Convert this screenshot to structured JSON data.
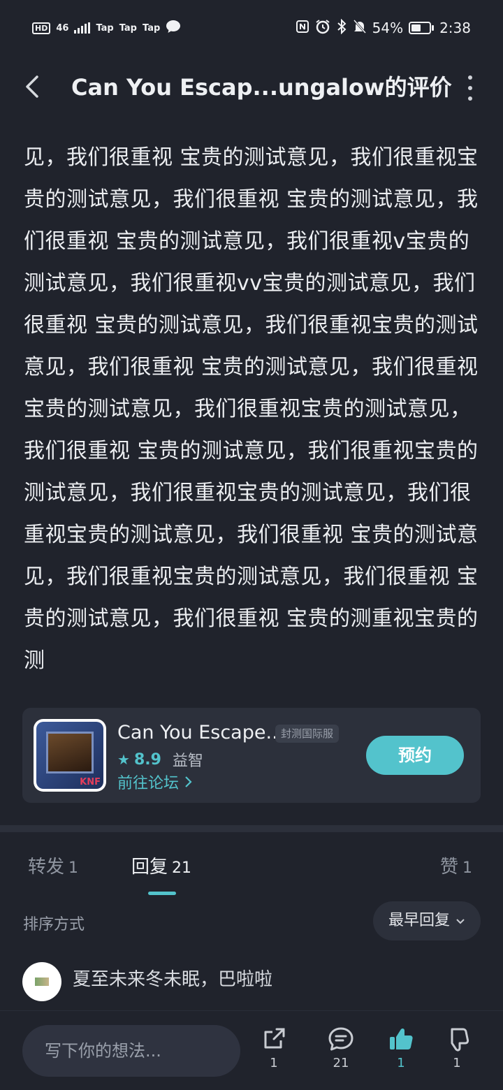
{
  "status_bar": {
    "left_items": [
      "HD",
      "46",
      "Tap",
      "Tap",
      "Tap"
    ],
    "battery_percent": "54%",
    "battery_level": 0.54,
    "time": "2:38"
  },
  "header": {
    "title": "Can You Escap...ungalow的评价"
  },
  "review": {
    "text": "见，我们很重视 宝贵的测试意见，我们很重视宝贵的测试意见，我们很重视 宝贵的测试意见，我们很重视 宝贵的测试意见，我们很重视v宝贵的测试意见，我们很重视vv宝贵的测试意见，我们很重视 宝贵的测试意见，我们很重视宝贵的测试意见，我们很重视 宝贵的测试意见，我们很重视宝贵的测试意见，我们很重视宝贵的测试意见，我们很重视 宝贵的测试意见，我们很重视宝贵的测试意见，我们很重视宝贵的测试意见，我们很重视宝贵的测试意见，我们很重视 宝贵的测试意见，我们很重视宝贵的测试意见，我们很重视 宝贵的测试意见，我们很重视 宝贵的测重视宝贵的测"
  },
  "app_card": {
    "name": "Can You Escape...",
    "badge": "封测国际服",
    "rating": "8.9",
    "genre": "益智",
    "forum_link": "前往论坛",
    "reserve_label": "预约",
    "icon_logo": "KNF"
  },
  "tabs": [
    {
      "label": "转发",
      "count": "1"
    },
    {
      "label": "回复",
      "count": "21"
    },
    {
      "label": "赞",
      "count": "1"
    }
  ],
  "sort": {
    "label": "排序方式",
    "selected": "最早回复"
  },
  "comment": {
    "text": "夏至未来冬未眠，巴啦啦"
  },
  "bottom_bar": {
    "input_placeholder": "写下你的想法...",
    "share_count": "1",
    "reply_count": "21",
    "like_count": "1",
    "dislike_count": "1"
  },
  "colors": {
    "background": "#20232c",
    "accent": "#53c3cc",
    "card": "#2c303b"
  }
}
